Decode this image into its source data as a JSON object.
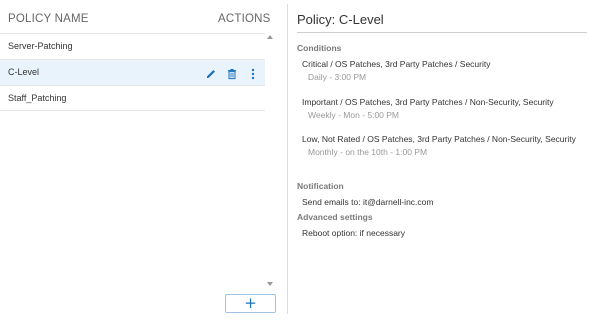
{
  "list": {
    "header_name": "POLICY NAME",
    "header_actions": "ACTIONS",
    "policies": [
      {
        "name": "Server-Patching"
      },
      {
        "name": "C-Level"
      },
      {
        "name": "Staff_Patching"
      }
    ]
  },
  "detail": {
    "title": "Policy: C-Level",
    "conditions_label": "Conditions",
    "conditions": [
      {
        "text": "Critical / OS Patches, 3rd Party Patches / Security",
        "schedule": "Daily - 3:00 PM"
      },
      {
        "text": "Important / OS Patches, 3rd Party Patches / Non-Security, Security",
        "schedule": "Weekly - Mon - 5:00 PM"
      },
      {
        "text": "Low, Not Rated / OS Patches, 3rd Party Patches / Non-Security, Security",
        "schedule": "Monthly - on the 10th - 1:00 PM"
      }
    ],
    "notification_label": "Notification",
    "notification_text": "Send emails to: it@darnell-inc.com",
    "advanced_label": "Advanced settings",
    "advanced_text": "Reboot option: if necessary"
  },
  "icons": {
    "edit": "pencil-icon",
    "delete": "trash-icon",
    "more": "more-vertical-icon",
    "add": "plus-icon"
  },
  "colors": {
    "accent": "#1e73be",
    "selected_row": "#e8f3fc",
    "section_label": "#7a7a7a",
    "schedule_text": "#999999"
  },
  "add_button": {
    "label": "+"
  }
}
